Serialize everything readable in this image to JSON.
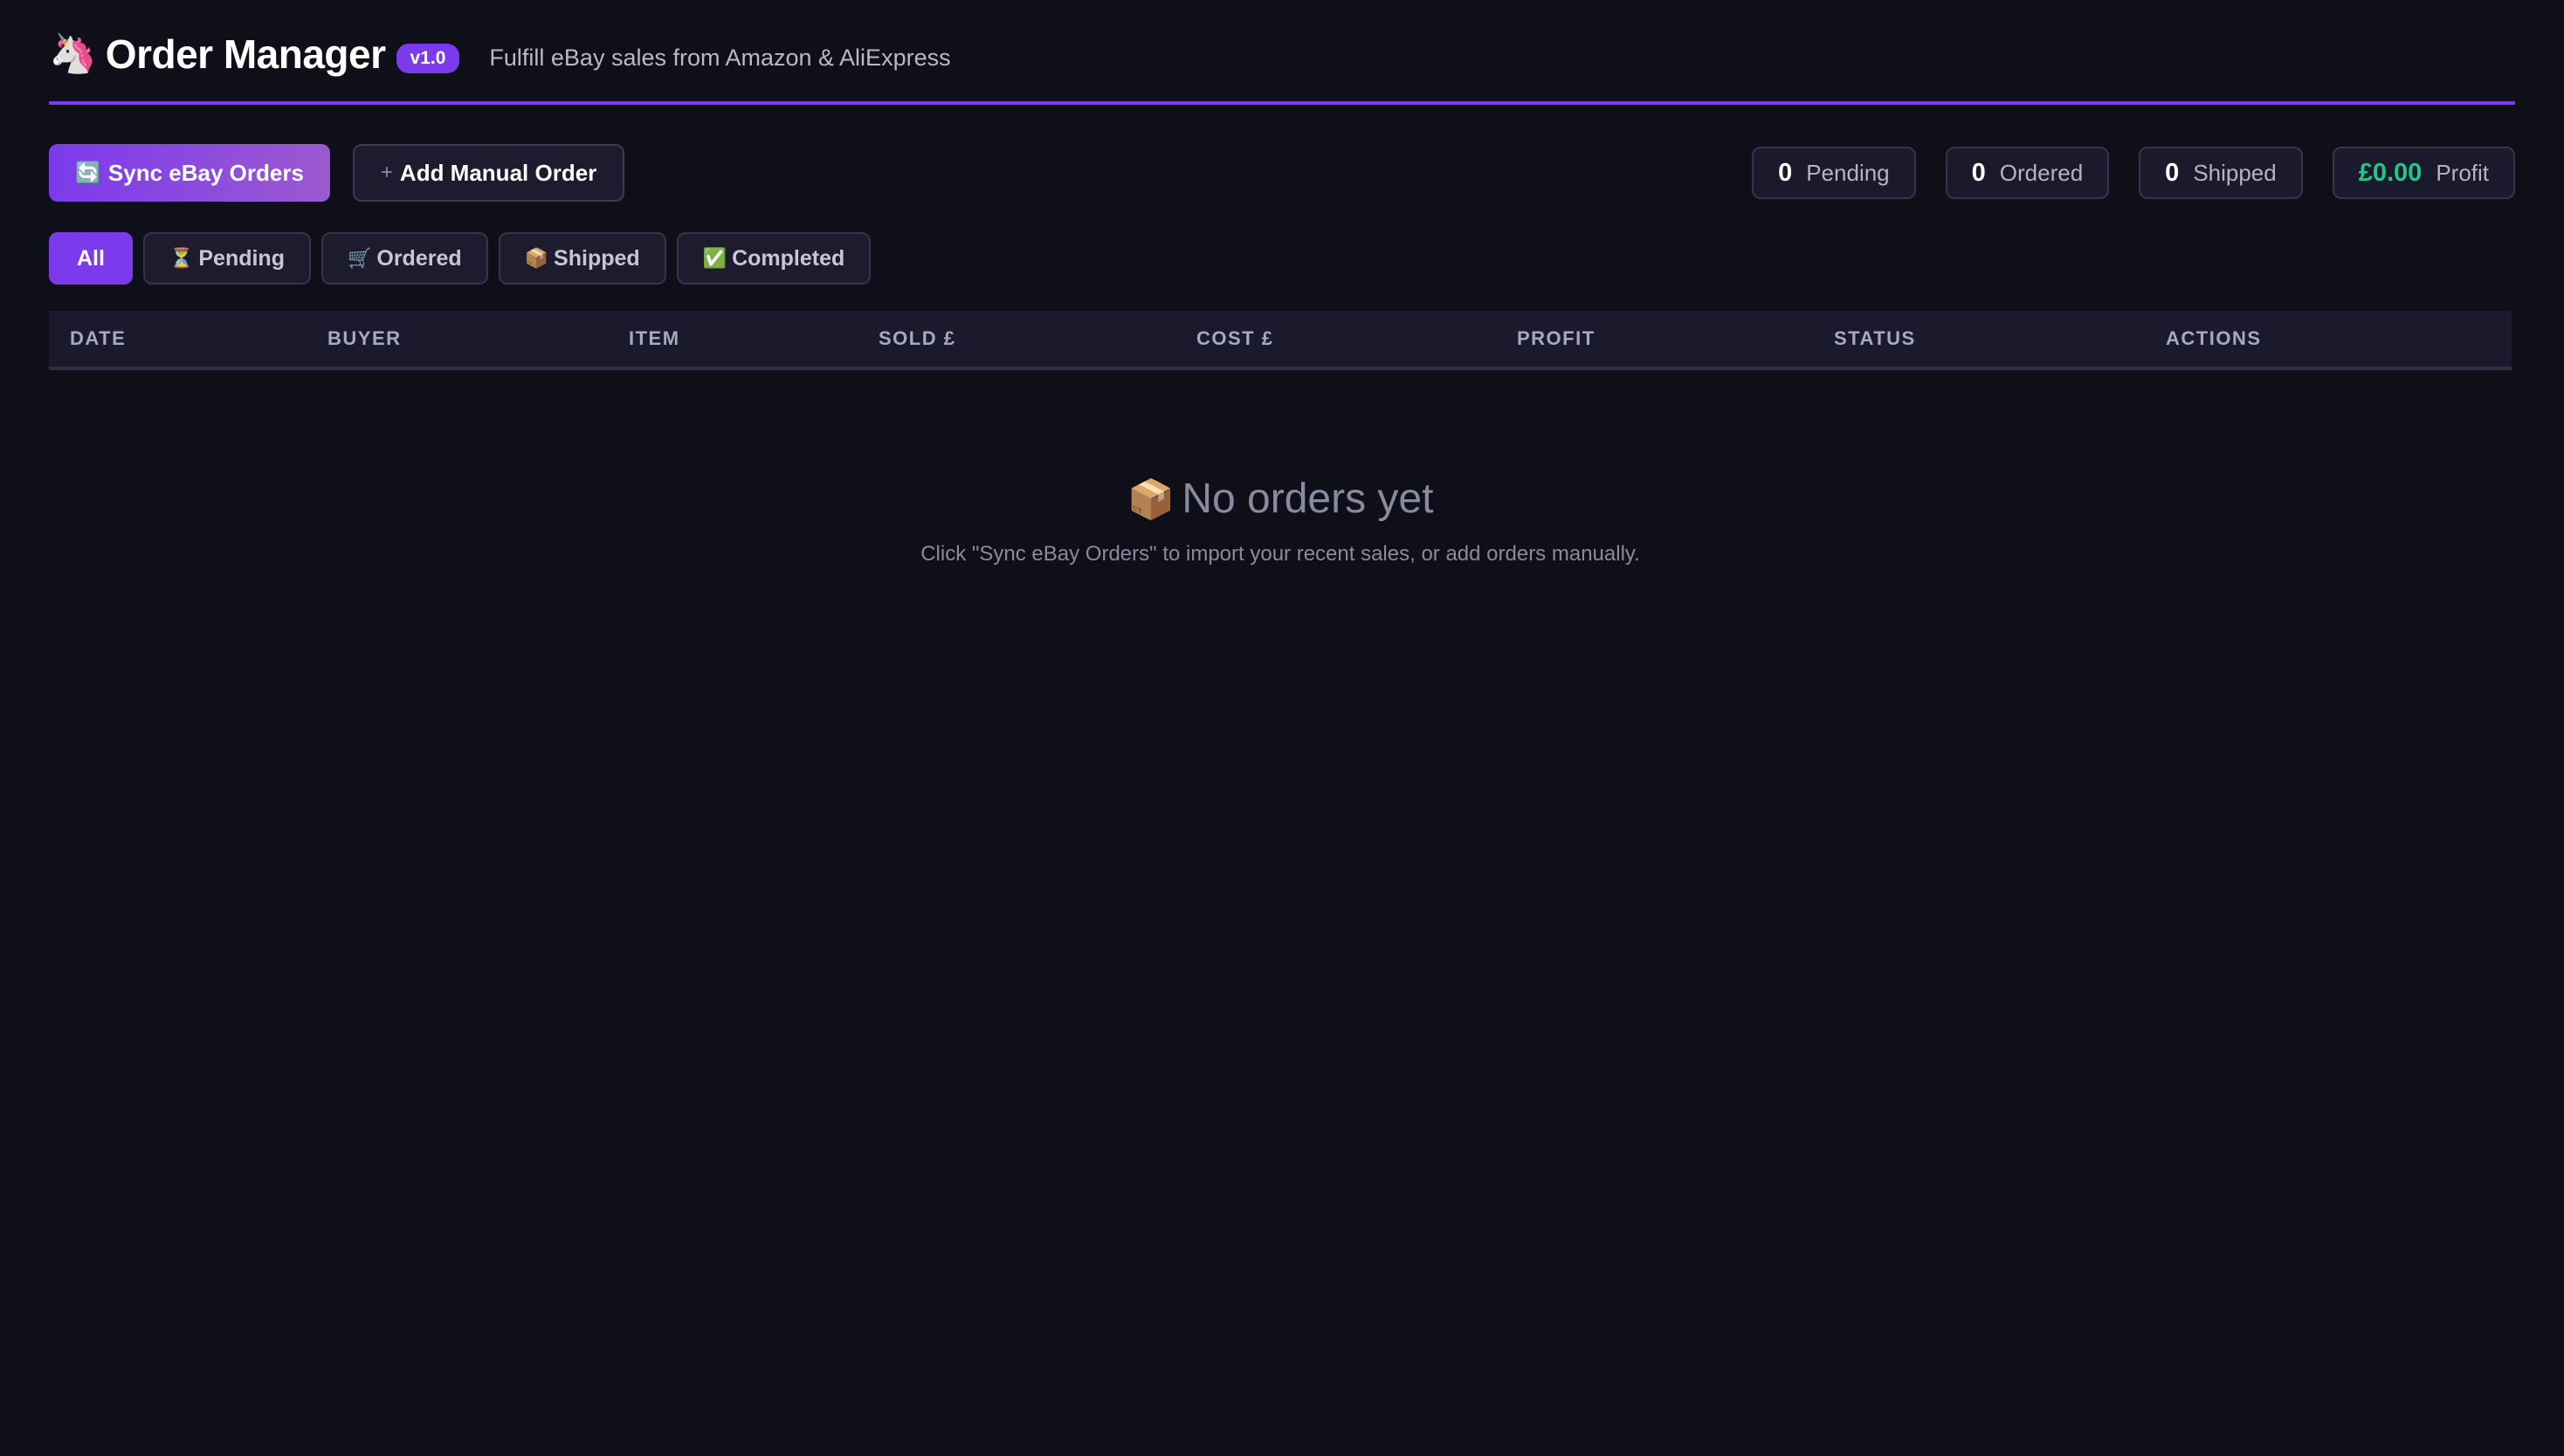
{
  "header": {
    "logo_icon": "🦄",
    "title": "Order Manager",
    "version": "v1.0",
    "subtitle": "Fulfill eBay sales from Amazon & AliExpress"
  },
  "toolbar": {
    "sync_icon": "🔄",
    "sync_label": "Sync eBay Orders",
    "add_icon": "+",
    "add_label": "Add Manual Order"
  },
  "stats": [
    {
      "value": "0",
      "label": "Pending"
    },
    {
      "value": "0",
      "label": "Ordered"
    },
    {
      "value": "0",
      "label": "Shipped"
    },
    {
      "value": "£0.00",
      "label": "Profit"
    }
  ],
  "filters": [
    {
      "icon": "",
      "label": "All",
      "active": true
    },
    {
      "icon": "⏳",
      "label": "Pending",
      "active": false
    },
    {
      "icon": "🛒",
      "label": "Ordered",
      "active": false
    },
    {
      "icon": "📦",
      "label": "Shipped",
      "active": false
    },
    {
      "icon": "✅",
      "label": "Completed",
      "active": false
    }
  ],
  "table": {
    "columns": [
      "Date",
      "Buyer",
      "Item",
      "Sold £",
      "Cost £",
      "Profit",
      "Status",
      "Actions"
    ],
    "rows": []
  },
  "empty_state": {
    "icon": "📦",
    "title": "No orders yet",
    "description": "Click \"Sync eBay Orders\" to import your recent sales, or add orders manually."
  },
  "colors": {
    "background": "#0f0f1a",
    "accent": "#7c3aed",
    "profit": "#22c58b"
  }
}
